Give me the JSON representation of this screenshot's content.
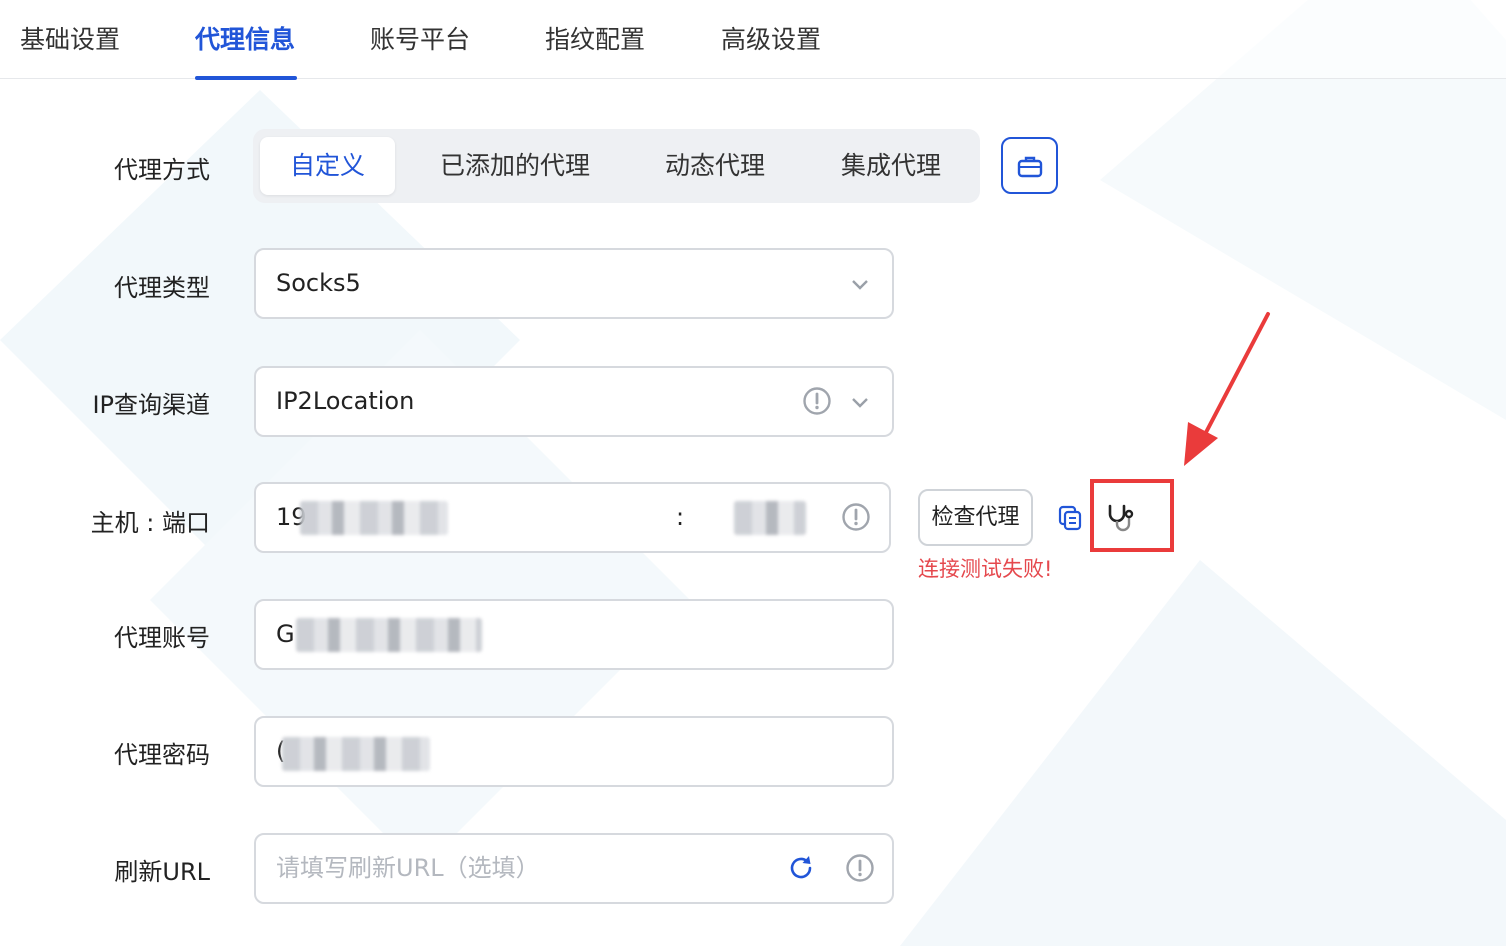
{
  "tabs": [
    {
      "label": "基础设置"
    },
    {
      "label": "代理信息"
    },
    {
      "label": "账号平台"
    },
    {
      "label": "指纹配置"
    },
    {
      "label": "高级设置"
    }
  ],
  "active_tab": "代理信息",
  "form": {
    "proxy_mode": {
      "label": "代理方式",
      "options": [
        "自定义",
        "已添加的代理",
        "动态代理",
        "集成代理"
      ],
      "selected": "自定义"
    },
    "proxy_type": {
      "label": "代理类型",
      "value": "Socks5"
    },
    "ip_channel": {
      "label": "IP查询渠道",
      "value": "IP2Location"
    },
    "host_port": {
      "label": "主机 : 端口",
      "host_prefix": "19",
      "separator": ":"
    },
    "account": {
      "label": "代理账号",
      "value_prefix": "G"
    },
    "password": {
      "label": "代理密码",
      "value_prefix": "("
    },
    "refresh_url": {
      "label": "刷新URL",
      "placeholder": "请填写刷新URL（选填）"
    }
  },
  "actions": {
    "check_proxy_label": "检查代理",
    "error_message": "连接测试失败!"
  },
  "icons": {
    "proxy_mode_extra": "briefcase-icon",
    "copy": "copy-icon",
    "test": "stethoscope-icon",
    "refresh": "refresh-icon",
    "info": "info-icon",
    "dropdown": "chevron-down-icon"
  },
  "colors": {
    "accent": "#2155d8",
    "error": "#e5484d",
    "highlight": "#ea3b3b"
  }
}
